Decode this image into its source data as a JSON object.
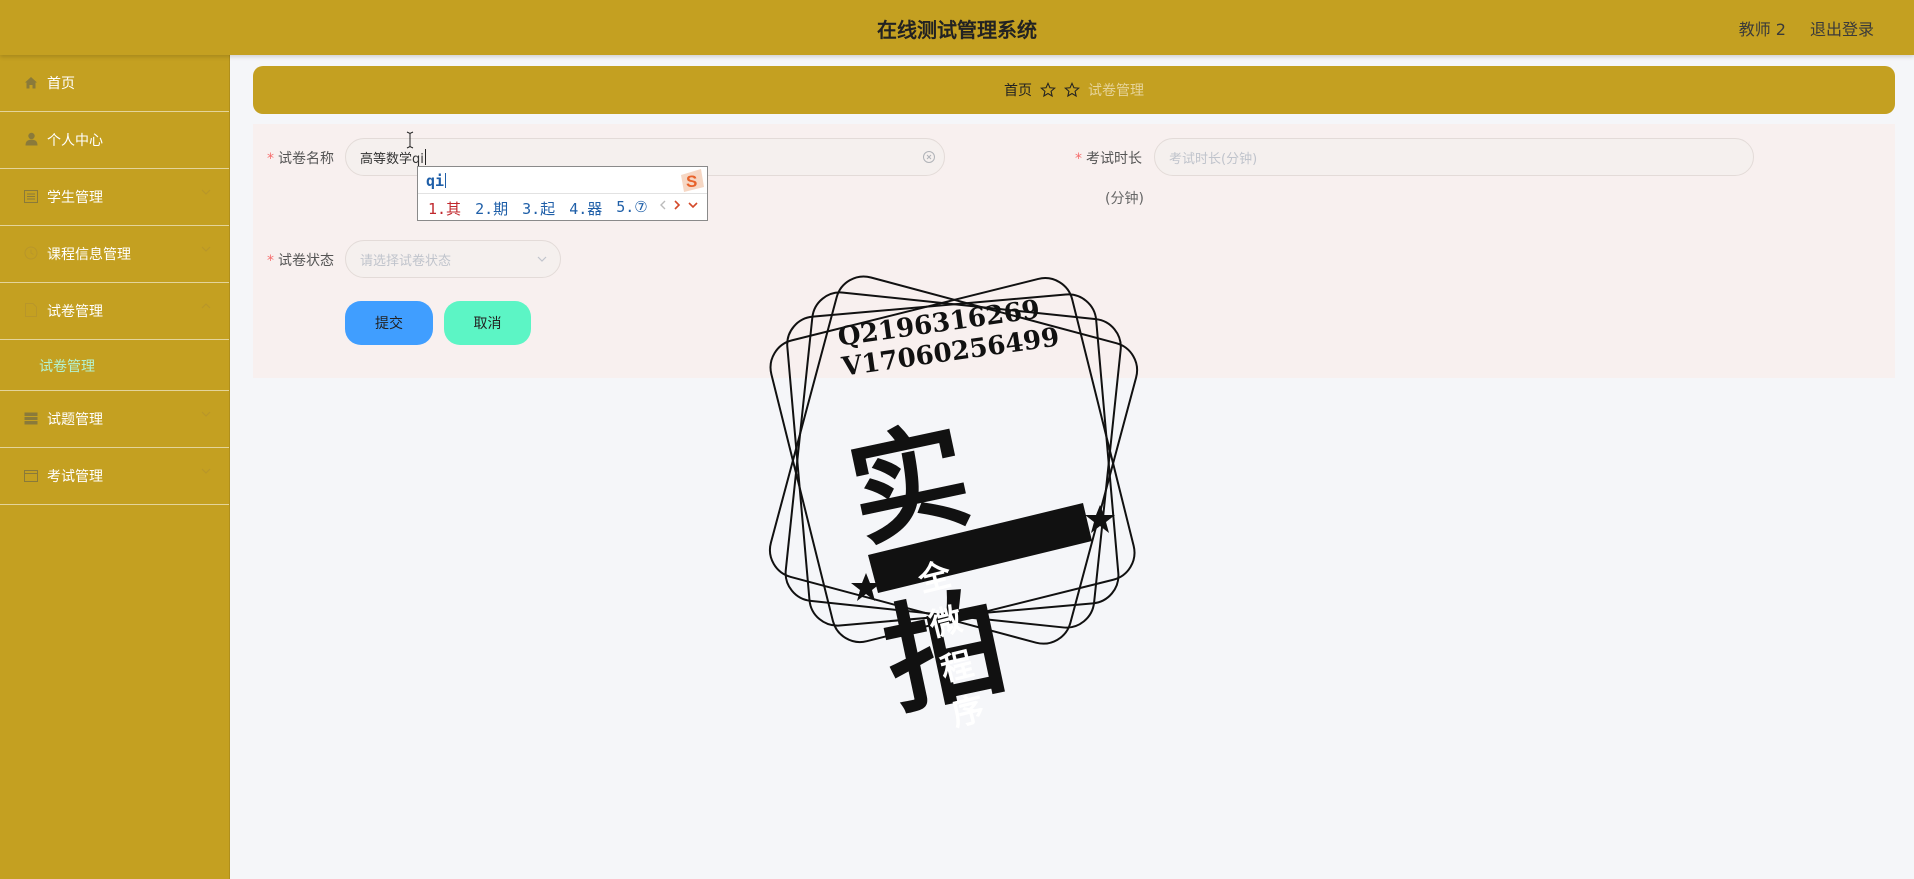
{
  "app": {
    "title": "在线测试管理系统",
    "user": "教师 2",
    "logout": "退出登录"
  },
  "sidebar": {
    "items": [
      {
        "label": "首页",
        "icon": "home-icon"
      },
      {
        "label": "个人中心",
        "icon": "user-icon"
      },
      {
        "label": "学生管理",
        "icon": "list-icon"
      },
      {
        "label": "课程信息管理",
        "icon": "clock-icon"
      },
      {
        "label": "试卷管理",
        "icon": "document-icon",
        "expanded": true,
        "children": [
          {
            "label": "试卷管理",
            "active": true
          }
        ]
      },
      {
        "label": "试题管理",
        "icon": "grid-icon"
      },
      {
        "label": "考试管理",
        "icon": "calendar-icon"
      }
    ]
  },
  "breadcrumb": {
    "home": "首页",
    "current": "试卷管理"
  },
  "form": {
    "name": {
      "label": "试卷名称",
      "value": "高等数学qi"
    },
    "duration": {
      "label": "考试时长",
      "placeholder": "考试时长(分钟)",
      "unit": "(分钟)"
    },
    "status": {
      "label": "试卷状态",
      "placeholder": "请选择试卷状态"
    },
    "submit": "提交",
    "cancel": "取消"
  },
  "ime": {
    "composition": "qi",
    "candidates": [
      "1.其",
      "2.期",
      "3.起",
      "4.器",
      "5.⑦"
    ]
  },
  "watermark": {
    "line1": "Q2196316269",
    "line2": "V17060256499",
    "big": "实拍",
    "banner": "全微程序"
  },
  "colors": {
    "accent": "#c4a021",
    "submit": "#409eff",
    "cancel": "#5cf5c5",
    "submenu_active": "#b4f3d1"
  }
}
